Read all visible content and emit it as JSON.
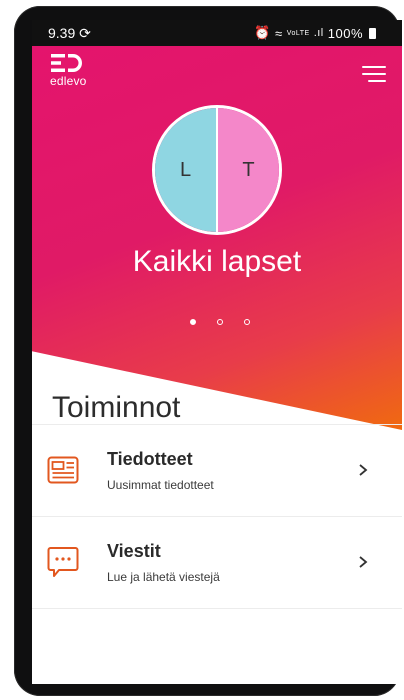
{
  "status_bar": {
    "time": "9.39",
    "sync_icon": "sync-icon",
    "alarm_icon": "alarm-icon",
    "wifi_icon": "wifi-icon",
    "volte_text": "VoLTE",
    "signal_icon": "signal-icon",
    "battery_text": "100%",
    "battery_icon": "battery-icon"
  },
  "header": {
    "logo_text": "edlevo",
    "logo_icon": "edlevo-logo-icon",
    "menu_icon": "hamburger-menu-icon"
  },
  "profile": {
    "left_initial": "L",
    "right_initial": "T",
    "left_color": "#8fd6e2",
    "right_color": "#f487c9",
    "title": "Kaikki lapset"
  },
  "pager": {
    "total": 3,
    "active": 0
  },
  "actions": {
    "title": "Toiminnot",
    "items": [
      {
        "label": "Tiedotteet",
        "sublabel": "Uusimmat tiedotteet",
        "icon": "newspaper-icon"
      },
      {
        "label": "Viestit",
        "sublabel": "Lue ja lähetä viestejä",
        "icon": "message-bubble-icon"
      }
    ]
  },
  "colors": {
    "brand_pink": "#e4146d",
    "brand_orange": "#f06a10",
    "icon_orange": "#e2571f"
  }
}
